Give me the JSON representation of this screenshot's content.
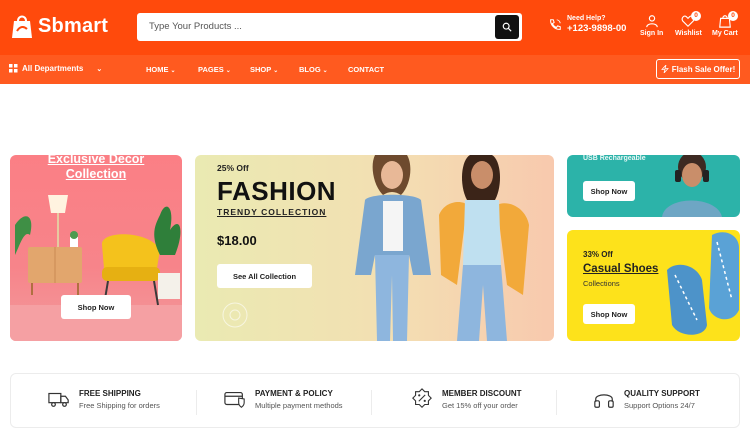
{
  "header": {
    "logo_text": "Sbmart",
    "search_placeholder": "Type Your Products ...",
    "help_label": "Need Help?",
    "help_phone": "+123-9898-00",
    "signin_label": "Sign In",
    "wishlist_label": "Wishlist",
    "wishlist_count": "0",
    "cart_label": "My Cart",
    "cart_count": "0",
    "brand_color": "#ff4a0c"
  },
  "nav": {
    "departments": "All Departments",
    "items": [
      "HOME",
      "PAGES",
      "SHOP",
      "BLOG",
      "CONTACT"
    ],
    "flash_sale": "Flash Sale Offer!"
  },
  "banners": {
    "decor": {
      "title_line1": "Exclusive Decor",
      "title_line2": "Collection",
      "button": "Shop Now"
    },
    "fashion": {
      "discount": "25% Off",
      "title": "FASHION",
      "subtitle": "TRENDY COLLECTION",
      "price": "$18.00",
      "button": "See All Collection"
    },
    "usb": {
      "text": "USB Rechargeable",
      "button": "Shop Now"
    },
    "shoes": {
      "discount": "33% Off",
      "title": "Casual Shoes",
      "subtitle": "Collections",
      "button": "Shop Now"
    }
  },
  "features": [
    {
      "icon": "truck-icon",
      "title": "FREE SHIPPING",
      "desc": "Free Shipping for orders"
    },
    {
      "icon": "card-shield-icon",
      "title": "PAYMENT & POLICY",
      "desc": "Multiple payment methods"
    },
    {
      "icon": "discount-badge-icon",
      "title": "MEMBER DISCOUNT",
      "desc": "Get 15% off your order"
    },
    {
      "icon": "headphones-icon",
      "title": "QUALITY SUPPORT",
      "desc": "Support Options 24/7"
    }
  ]
}
